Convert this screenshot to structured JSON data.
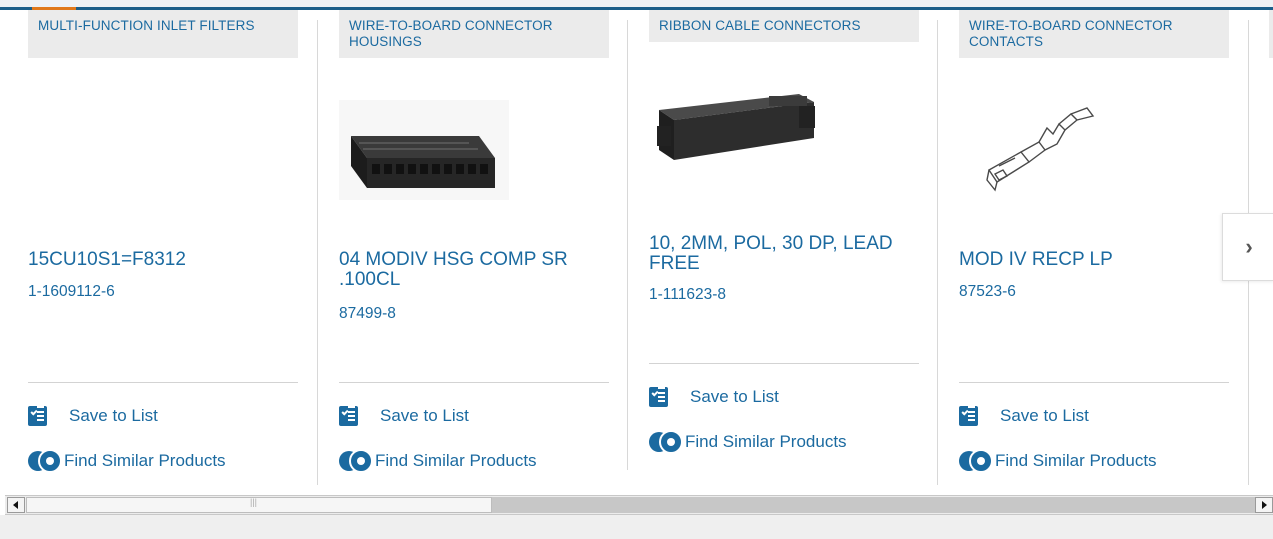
{
  "colors": {
    "link": "#1b6aa0",
    "accent_bar": "#1b5f8a",
    "accent_orange": "#e0791b",
    "category_bg": "#ebebeb"
  },
  "cards": [
    {
      "category": "MULTI-FUNCTION INLET FILTERS",
      "name": "15CU10S1=F8312",
      "part_number": "1-1609112-6",
      "has_image": false,
      "save_label": "Save to List",
      "similar_label": "Find Similar Products"
    },
    {
      "category": "WIRE-TO-BOARD CONNECTOR HOUSINGS",
      "name": "04 MODIV HSG COMP SR .100CL",
      "part_number": "87499-8",
      "has_image": true,
      "image_icon": "connector-housing-image",
      "save_label": "Save to List",
      "similar_label": "Find Similar Products"
    },
    {
      "category": "RIBBON CABLE CONNECTORS",
      "name": "10, 2MM, POL, 30 DP, LEAD FREE",
      "part_number": "1-111623-8",
      "has_image": true,
      "image_icon": "ribbon-connector-image",
      "save_label": "Save to List",
      "similar_label": "Find Similar Products"
    },
    {
      "category": "WIRE-TO-BOARD CONNECTOR CONTACTS",
      "name": "MOD IV RECP LP",
      "part_number": "87523-6",
      "has_image": true,
      "image_icon": "crimp-contact-image",
      "save_label": "Save to List",
      "similar_label": "Find Similar Products"
    }
  ],
  "carousel": {
    "next_icon": "chevron-right-icon",
    "next_glyph": "›"
  },
  "scrollbar": {
    "position_fraction": 0.0
  }
}
